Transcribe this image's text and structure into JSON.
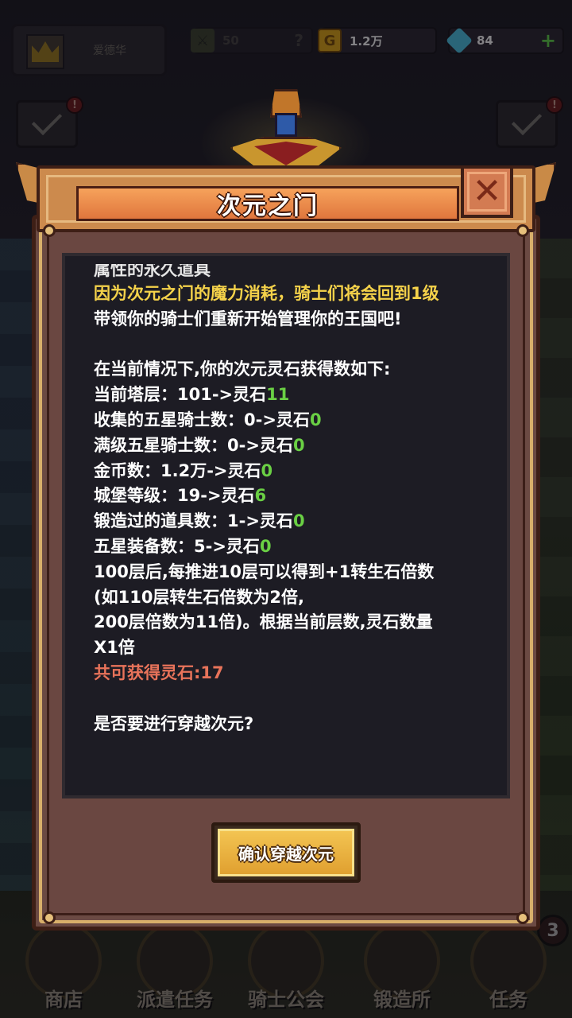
{
  "topbar": {
    "player_name": "爱德华",
    "shield_value": "50",
    "shield_question": "?",
    "gold_value": "1.2万",
    "gem_value": "84",
    "gem_plus": "+",
    "alert_left": "!",
    "alert_right": "!"
  },
  "dialog": {
    "title": "次元之门",
    "close_symbol": "✕",
    "partial_line": "属性的永久道具",
    "lines": [
      {
        "text": "因为次元之门的魔力消耗，骑士们将会回到1级",
        "highlight": "",
        "style": "yellow"
      },
      {
        "text": "带领你的骑士们重新开始管理你的王国吧!",
        "highlight": "",
        "style": "white"
      },
      {
        "text": "",
        "highlight": "",
        "style": "gap"
      },
      {
        "text": "在当前情况下,你的次元灵石获得数如下:",
        "highlight": "",
        "style": "white"
      },
      {
        "text": "当前塔层：101->灵石",
        "highlight": "11",
        "style": "white"
      },
      {
        "text": "收集的五星骑士数：0->灵石",
        "highlight": "0",
        "style": "white"
      },
      {
        "text": "满级五星骑士数：0->灵石",
        "highlight": "0",
        "style": "white"
      },
      {
        "text": "金币数：1.2万->灵石",
        "highlight": "0",
        "style": "white"
      },
      {
        "text": "城堡等级：19->灵石",
        "highlight": "6",
        "style": "white"
      },
      {
        "text": "锻造过的道具数：1->灵石",
        "highlight": "0",
        "style": "white"
      },
      {
        "text": "五星装备数：5->灵石",
        "highlight": "0",
        "style": "white"
      },
      {
        "text": "100层后,每推进10层可以得到+1转生石倍数",
        "highlight": "",
        "style": "white"
      },
      {
        "text": "(如110层转生石倍数为2倍,",
        "highlight": "",
        "style": "white"
      },
      {
        "text": "200层倍数为11倍)。根据当前层数,灵石数量",
        "highlight": "",
        "style": "white"
      },
      {
        "text": "X1倍",
        "highlight": "",
        "style": "white"
      },
      {
        "text": "共可获得灵石:17",
        "highlight": "",
        "style": "red"
      },
      {
        "text": "",
        "highlight": "",
        "style": "gap"
      },
      {
        "text": "是否要进行穿越次元?",
        "highlight": "",
        "style": "white"
      }
    ],
    "confirm_label": "确认穿越次元"
  },
  "bottom_nav": {
    "items": [
      "商店",
      "派遣任务",
      "骑士公会",
      "锻造所",
      "任务"
    ],
    "badge": "3"
  },
  "colors": {
    "yellow_text": "#f5d24a",
    "green_value": "#6ad044",
    "red_total": "#e8735a",
    "button_gold": "#f3c452",
    "frame": "#6b4a43"
  }
}
